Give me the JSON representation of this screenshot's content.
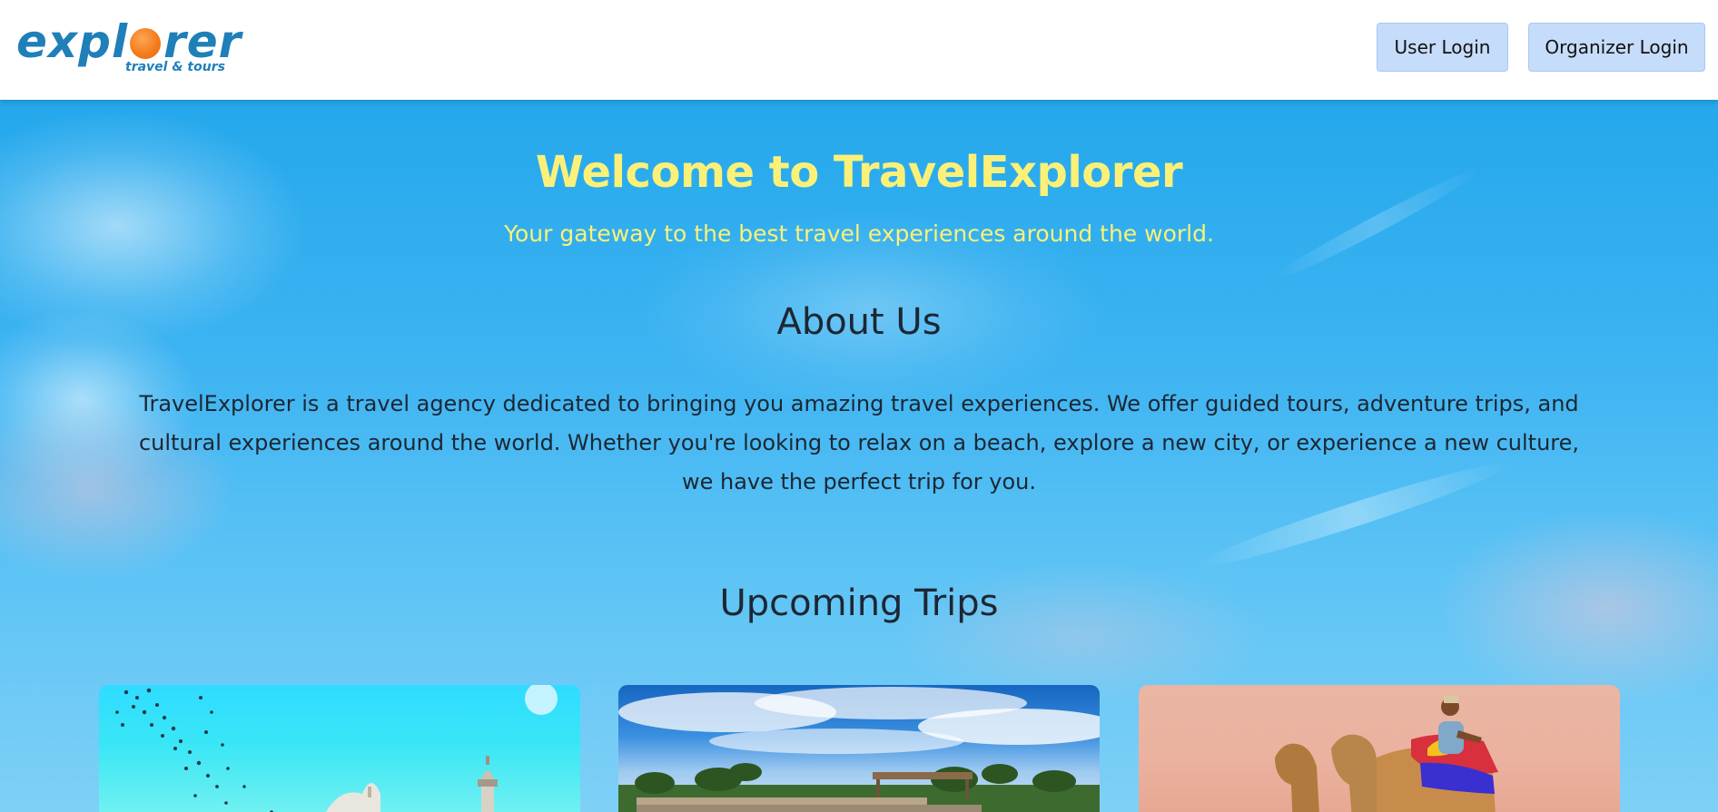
{
  "header": {
    "logo": {
      "word_before": "expl",
      "word_after": "rer",
      "tagline": "travel & tours",
      "brand_color": "#1f7fb8",
      "accent_color": "#f27a1a"
    },
    "buttons": {
      "user_login": "User Login",
      "organizer_login": "Organizer Login"
    }
  },
  "hero": {
    "title": "Welcome to TravelExplorer",
    "subtitle": "Your gateway to the best travel experiences around the world."
  },
  "about": {
    "heading": "About Us",
    "text": "TravelExplorer is a travel agency dedicated to bringing you amazing travel experiences. We offer guided tours, adventure trips, and cultural experiences around the world. Whether you're looking to relax on a beach, explore a new city, or experience a new culture, we have the perfect trip for you."
  },
  "trips": {
    "heading": "Upcoming Trips",
    "cards": [
      {
        "image": "mosque-minaret-birds-moon-image"
      },
      {
        "image": "beach-palm-trees-clouds-image"
      },
      {
        "image": "desert-camel-rider-image"
      }
    ]
  },
  "colors": {
    "hero_text": "#fbf178",
    "heading_text": "#1c2733",
    "button_bg": "#c6dcfb"
  }
}
